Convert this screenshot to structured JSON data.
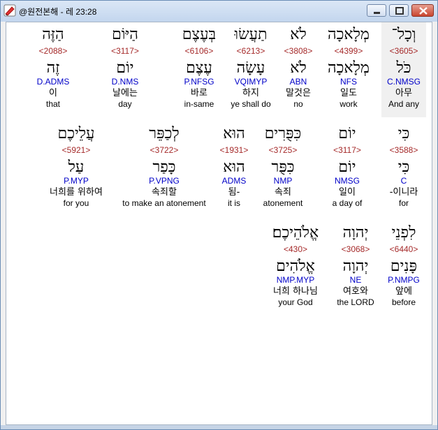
{
  "window": {
    "title": "@원전본해 - 레 23:28",
    "icon": "app-pen-icon"
  },
  "verse_rows": [
    {
      "row": 1,
      "words": [
        {
          "hebrew": "וְכָל־",
          "strong": "<3605>",
          "lemma": "כֹּל",
          "morph": "C.NMSG",
          "korean": "아무",
          "english": "And any",
          "selected": true
        },
        {
          "hebrew": "מְלָאכָה",
          "strong": "<4399>",
          "lemma": "מְלָאכָה",
          "morph": "NFS",
          "korean": "일도",
          "english": "work"
        },
        {
          "hebrew": "לֹא",
          "strong": "<3808>",
          "lemma": "לֹא",
          "morph": "ABN",
          "korean": "말것은",
          "english": "no"
        },
        {
          "hebrew": "תַעֲשׂוּ",
          "strong": "<6213>",
          "lemma": "עָשָׂה",
          "morph": "VQIMYP",
          "korean": "하지",
          "english": "ye shall do"
        },
        {
          "hebrew": "בְּעֶצֶם",
          "strong": "<6106>",
          "lemma": "עֶצֶם",
          "morph": "P.NFSG",
          "korean": "바로",
          "english": "in-same"
        },
        {
          "hebrew": "הַיּוֹם",
          "strong": "<3117>",
          "lemma": "יוֹם",
          "morph": "D.NMS",
          "korean": "날에는",
          "english": "day"
        },
        {
          "hebrew": "הַזֶּה",
          "strong": "<2088>",
          "lemma": "זֶה",
          "morph": "D.ADMS",
          "korean": "이",
          "english": "that"
        }
      ]
    },
    {
      "row": 2,
      "words": [
        {
          "hebrew": "כִּי",
          "strong": "<3588>",
          "lemma": "כִּי",
          "morph": "C",
          "korean": "-이니라",
          "english": "for"
        },
        {
          "hebrew": "יוֹם",
          "strong": "<3117>",
          "lemma": "יוֹם",
          "morph": "NMSG",
          "korean": "일이",
          "english": "a day of"
        },
        {
          "hebrew": "כִּפֻּרִים",
          "strong": "<3725>",
          "lemma": "כִּפֻּר",
          "morph": "NMP",
          "korean": "속죄",
          "english": "atonement"
        },
        {
          "hebrew": "הוּא",
          "strong": "<1931>",
          "lemma": "הוּא",
          "morph": "ADMS",
          "korean": "됨-",
          "english": "it is"
        },
        {
          "hebrew": "לְכַפֵּר",
          "strong": "<3722>",
          "lemma": "כָּפַר",
          "morph": "P.VPNG",
          "korean": "속죄할",
          "english": "to make an atonement"
        },
        {
          "hebrew": "עֲלֵיכֶם",
          "strong": "<5921>",
          "lemma": "עַל",
          "morph": "P.MYP",
          "korean": "너희를 위하여",
          "english": "for you"
        }
      ]
    },
    {
      "row": 3,
      "words": [
        {
          "hebrew": "לִפְנֵי",
          "strong": "<6440>",
          "lemma": "פָּנִים",
          "morph": "P.NMPG",
          "korean": "앞에",
          "english": "before"
        },
        {
          "hebrew": "יְהוָה",
          "strong": "<3068>",
          "lemma": "יְהוָה",
          "morph": "NE",
          "korean": "여호와",
          "english": "the LORD"
        },
        {
          "hebrew": "אֱלֹהֵיכֶם׃",
          "strong": "<430>",
          "lemma": "אֱלֹהִים",
          "morph": "NMP.MYP",
          "korean": "너희 하나님",
          "english": "your God"
        }
      ]
    }
  ]
}
